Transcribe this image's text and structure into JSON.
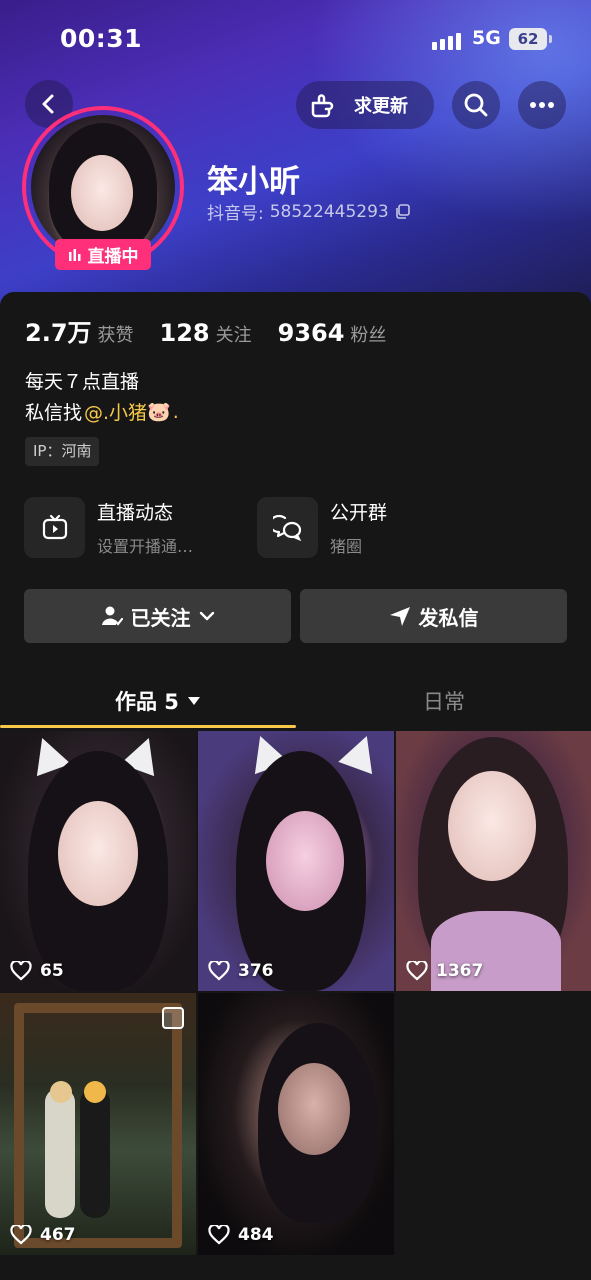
{
  "status_bar": {
    "time": "00:31",
    "network": "5G",
    "battery": "62"
  },
  "header": {
    "request_update_label": "求更新"
  },
  "profile": {
    "nickname": "笨小昕",
    "douyin_id_label": "抖音号:",
    "douyin_id": "58522445293",
    "live_badge": "直播中"
  },
  "stats": [
    {
      "value": "2.7万",
      "label": "获赞"
    },
    {
      "value": "128",
      "label": "关注"
    },
    {
      "value": "9364",
      "label": "粉丝"
    }
  ],
  "bio": {
    "line1": "每天７点直播",
    "line2_prefix": "私信找",
    "line2_mention": "@.小猪",
    "line2_emoji": "🐷",
    "line2_suffix": "."
  },
  "ip_tag": "IP：河南",
  "features": [
    {
      "title": "直播动态",
      "subtitle": "设置开播通…",
      "icon": "tv-icon"
    },
    {
      "title": "公开群",
      "subtitle": "猪圈",
      "icon": "chat-bubbles-icon"
    }
  ],
  "actions": {
    "follow_label": "已关注",
    "message_label": "发私信"
  },
  "tabs": [
    {
      "label": "作品 5",
      "active": true
    },
    {
      "label": "日常",
      "active": false
    }
  ],
  "videos": [
    {
      "likes": "65"
    },
    {
      "likes": "376"
    },
    {
      "likes": "1367"
    },
    {
      "likes": "467"
    },
    {
      "likes": "484"
    }
  ],
  "colors": {
    "live_pink": "#ff2f7a",
    "accent_yellow": "#f7c94b",
    "background": "#161616"
  }
}
